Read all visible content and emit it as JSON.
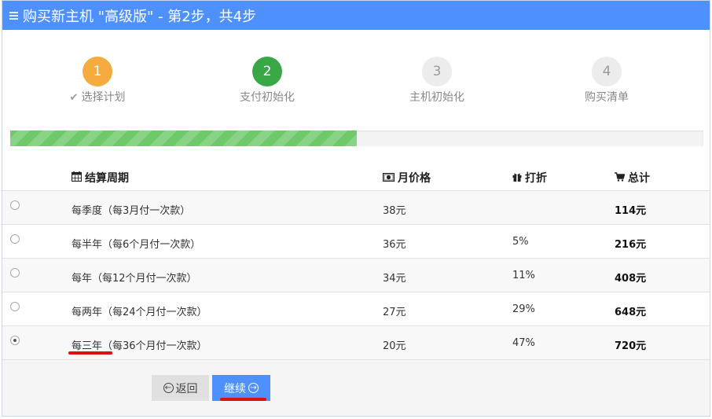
{
  "window": {
    "title": "购买新主机 \"高级版\" - 第2步，共4步"
  },
  "steps": [
    {
      "number": "1",
      "label": "选择计划",
      "state": "done",
      "color": "#f5ab3e"
    },
    {
      "number": "2",
      "label": "支付初始化",
      "state": "active",
      "color": "#3aa746"
    },
    {
      "number": "3",
      "label": "主机初始化",
      "state": "pending"
    },
    {
      "number": "4",
      "label": "购买清单",
      "state": "pending"
    }
  ],
  "progress": {
    "percent": 50
  },
  "table": {
    "headers": {
      "period": "结算周期",
      "monthly_price": "月价格",
      "discount": "打折",
      "total": "总计"
    },
    "rows": [
      {
        "period": "每季度（每3月付一次款）",
        "monthly_price": "38元",
        "discount": "",
        "total": "114元",
        "selected": false
      },
      {
        "period": "每半年（每6个月付一次款）",
        "monthly_price": "36元",
        "discount": "5%",
        "total": "216元",
        "selected": false
      },
      {
        "period": "每年（每12个月付一次款）",
        "monthly_price": "34元",
        "discount": "11%",
        "total": "408元",
        "selected": false
      },
      {
        "period": "每两年（每24个月付一次款）",
        "monthly_price": "27元",
        "discount": "29%",
        "total": "648元",
        "selected": false
      },
      {
        "period": "每三年（每36个月付一次款）",
        "monthly_price": "20元",
        "discount": "47%",
        "total": "720元",
        "selected": true
      }
    ]
  },
  "buttons": {
    "back": "返回",
    "next": "继续"
  },
  "colors": {
    "accent": "#4d90fe",
    "annotation": "#e01010"
  }
}
